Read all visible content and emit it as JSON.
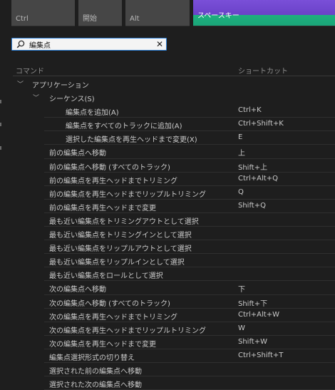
{
  "keyboard": {
    "keys": [
      {
        "id": "ctrl",
        "label": "Ctrl"
      },
      {
        "id": "start",
        "label": "開始"
      },
      {
        "id": "alt",
        "label": "Alt"
      },
      {
        "id": "space",
        "label": "スペースキー"
      }
    ],
    "space_colors": {
      "top": "#7a4fd8",
      "bottom": "#1eb07e"
    }
  },
  "search": {
    "value": "編集点"
  },
  "table": {
    "headers": {
      "command": "コマンド",
      "shortcut": "ショートカット"
    },
    "tree": {
      "group": "アプリケーション",
      "subgroup": "シーケンス(S)",
      "sub_items": [
        {
          "command": "編集点を追加(A)",
          "shortcut": "Ctrl+K"
        },
        {
          "command": "編集点をすべてのトラックに追加(A)",
          "shortcut": "Ctrl+Shift+K"
        },
        {
          "command": "選択した編集点を再生ヘッドまで変更(X)",
          "shortcut": "E"
        }
      ],
      "items": [
        {
          "command": "前の編集点へ移動",
          "shortcut": "上"
        },
        {
          "command": "前の編集点へ移動 (すべてのトラック)",
          "shortcut": "Shift+上"
        },
        {
          "command": "前の編集点を再生ヘッドまでトリミング",
          "shortcut": "Ctrl+Alt+Q"
        },
        {
          "command": "前の編集点を再生ヘッドまでリップルトリミング",
          "shortcut": "Q"
        },
        {
          "command": "前の編集点を再生ヘッドまで変更",
          "shortcut": "Shift+Q"
        },
        {
          "command": "最も近い編集点をトリミングアウトとして選択",
          "shortcut": ""
        },
        {
          "command": "最も近い編集点をトリミングインとして選択",
          "shortcut": ""
        },
        {
          "command": "最も近い編集点をリップルアウトとして選択",
          "shortcut": ""
        },
        {
          "command": "最も近い編集点をリップルインとして選択",
          "shortcut": ""
        },
        {
          "command": "最も近い編集点をロールとして選択",
          "shortcut": ""
        },
        {
          "command": "次の編集点へ移動",
          "shortcut": "下"
        },
        {
          "command": "次の編集点へ移動 (すべてのトラック)",
          "shortcut": "Shift+下"
        },
        {
          "command": "次の編集点を再生ヘッドまでトリミング",
          "shortcut": "Ctrl+Alt+W"
        },
        {
          "command": "次の編集点を再生ヘッドまでリップルトリミング",
          "shortcut": "W"
        },
        {
          "command": "次の編集点を再生ヘッドまで変更",
          "shortcut": "Shift+W"
        },
        {
          "command": "編集点選択形式の切り替え",
          "shortcut": "Ctrl+Shift+T"
        },
        {
          "command": "選択された前の編集点へ移動",
          "shortcut": ""
        },
        {
          "command": "選択された次の編集点へ移動",
          "shortcut": ""
        }
      ]
    }
  }
}
